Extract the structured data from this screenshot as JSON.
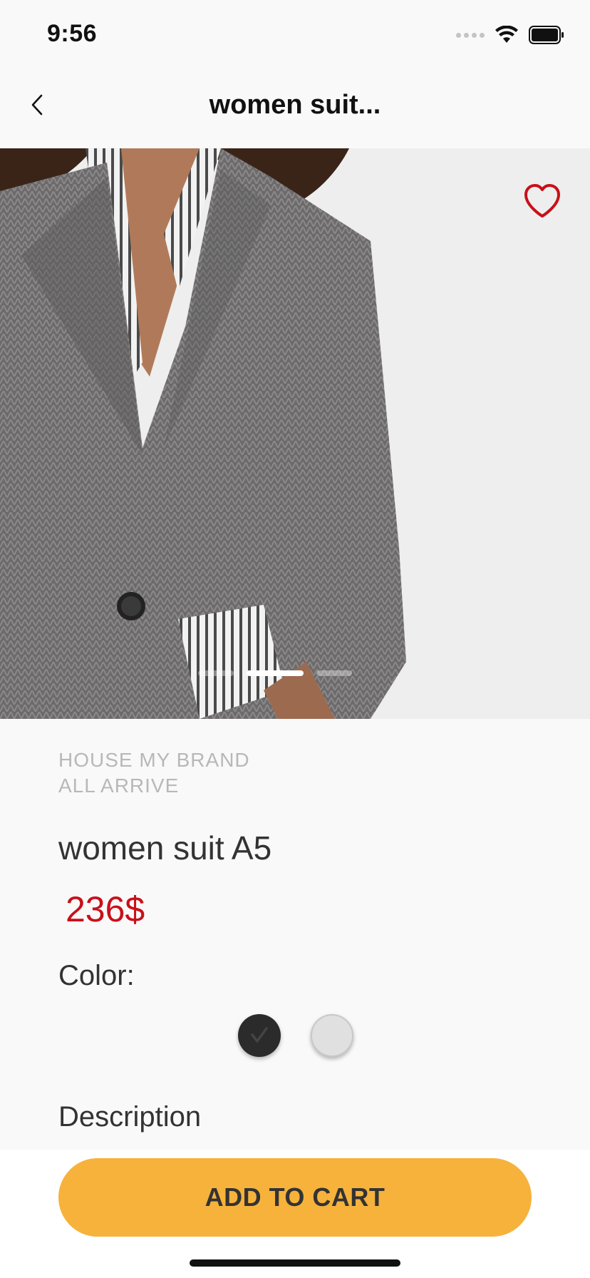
{
  "status_bar": {
    "time": "9:56"
  },
  "nav": {
    "title": "women suit..."
  },
  "product": {
    "brand_line1": "HOUSE MY BRAND",
    "brand_line2": "ALL ARRIVE",
    "name": "women suit A5",
    "price": "236$",
    "color_label": "Color:",
    "colors": [
      {
        "name": "dark",
        "hex": "#2b2b2b",
        "selected": true
      },
      {
        "name": "light",
        "hex": "#e0e0e0",
        "selected": false
      }
    ],
    "description_label": "Description",
    "image_pages": {
      "count": 3,
      "active_index": 1
    },
    "favorite_color": "#c8101a"
  },
  "cart": {
    "button_label": "ADD TO CART",
    "accent": "#f6b23b"
  },
  "icons": [
    "back-chevron-icon",
    "heart-icon",
    "checkmark-icon",
    "wifi-icon",
    "battery-icon",
    "signal-icon"
  ]
}
